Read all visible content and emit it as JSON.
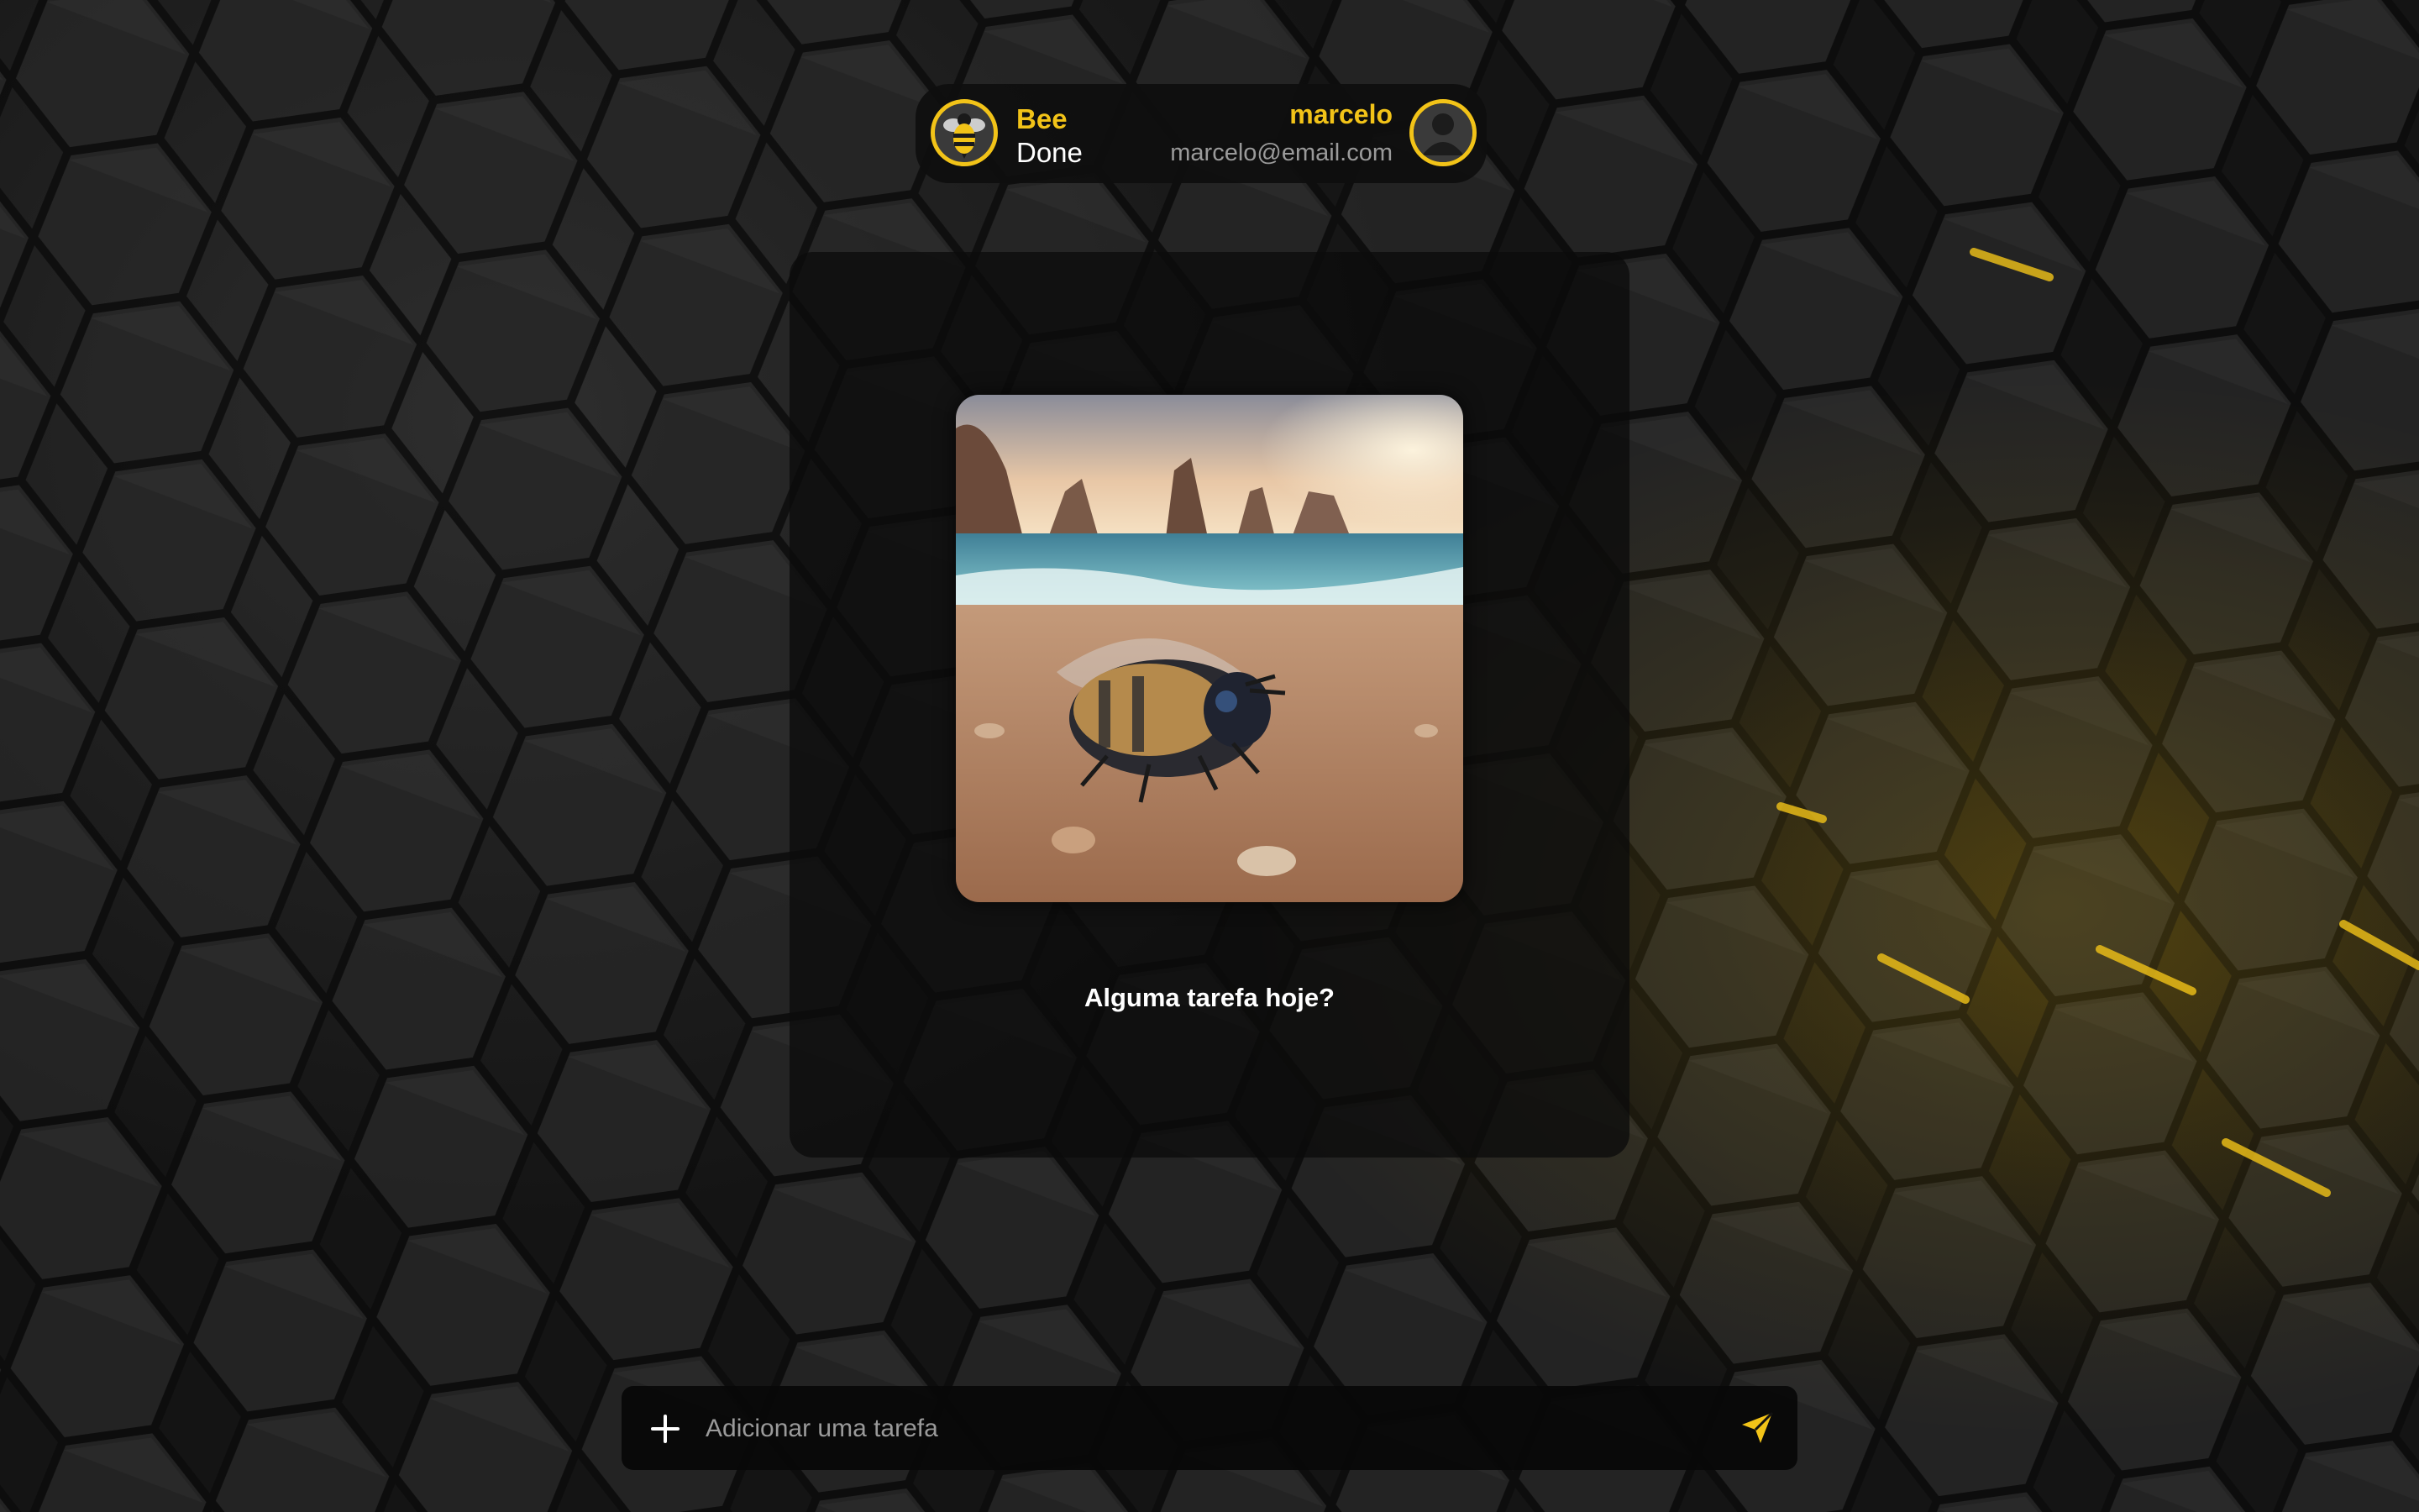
{
  "header": {
    "brand_top_first": "B",
    "brand_top_rest": "ee",
    "brand_bottom": "Done",
    "logo_icon": "bee-icon",
    "user": {
      "name": "marcelo",
      "email": "marcelo@email.com",
      "avatar_icon": "user-avatar-icon"
    }
  },
  "main": {
    "hero_image": "bee-on-beach-illustration",
    "empty_message": "Alguma tarefa hoje?"
  },
  "task_bar": {
    "add_icon": "plus-icon",
    "placeholder": "Adicionar uma tarefa",
    "value": "",
    "send_icon": "send-icon"
  },
  "colors": {
    "accent": "#f2c318",
    "background": "#121212",
    "surface": "#0e0e0e",
    "text_primary": "#ffffff",
    "text_secondary": "#9a9a9a"
  }
}
